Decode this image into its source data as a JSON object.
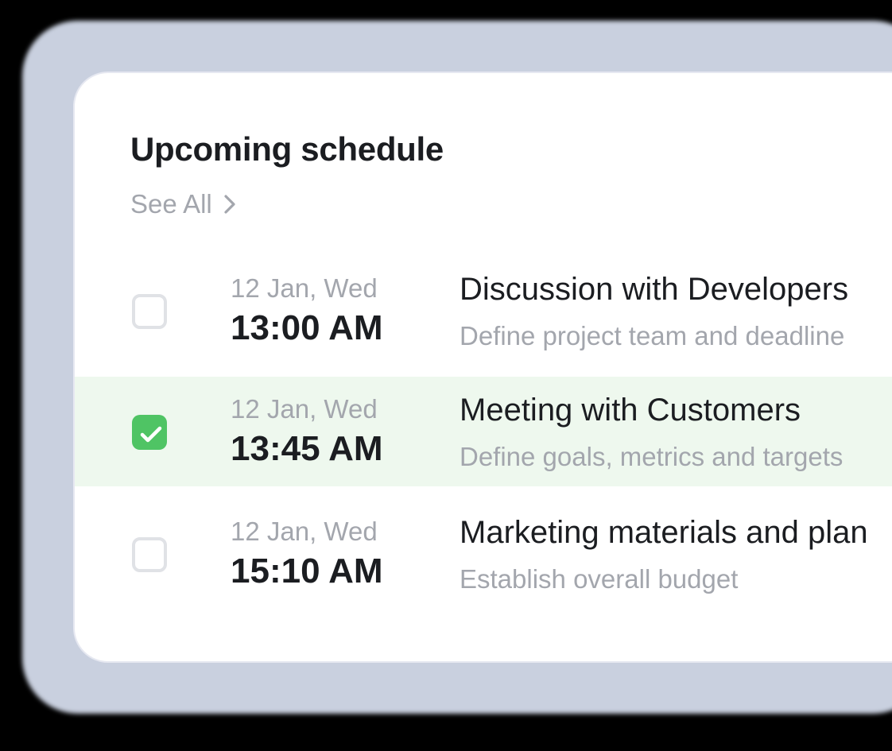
{
  "schedule": {
    "title": "Upcoming schedule",
    "see_all_label": "See All",
    "see_all_icon": "chevron-right-icon",
    "checked_icon": "checkmark-icon",
    "colors": {
      "checked_row_background": "#eef8ee",
      "checkbox_checked": "#4fc464",
      "checkbox_border": "#e0e2e6",
      "muted_text": "#a3a6ad",
      "primary_text": "#1b1d21"
    },
    "items": [
      {
        "checked": false,
        "date": "12 Jan, Wed",
        "time": "13:00 AM",
        "title": "Discussion with Developers",
        "description": "Define project team and deadline"
      },
      {
        "checked": true,
        "date": "12 Jan, Wed",
        "time": "13:45 AM",
        "title": "Meeting with Customers",
        "description": "Define goals, metrics and targets"
      },
      {
        "checked": false,
        "date": "12 Jan, Wed",
        "time": "15:10 AM",
        "title": "Marketing materials and plan",
        "description": "Establish overall budget"
      }
    ]
  }
}
